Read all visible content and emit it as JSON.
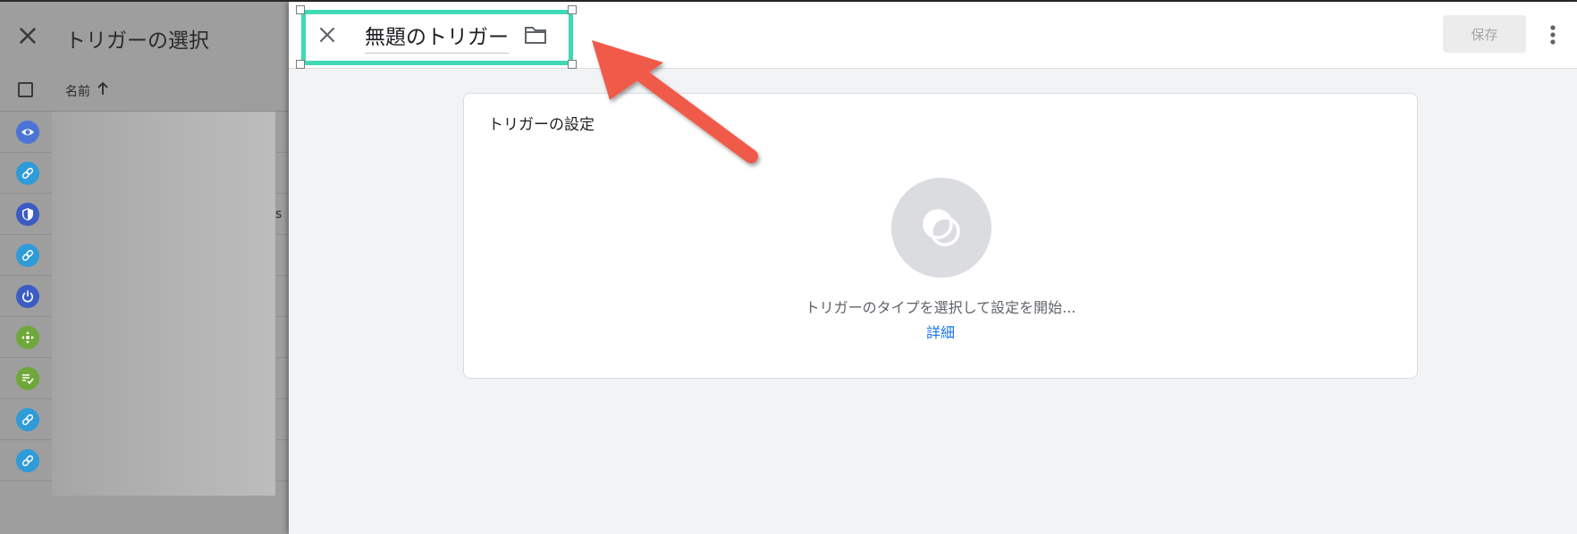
{
  "background_panel": {
    "title": "トリガーの選択",
    "column_name": "名前",
    "partial_text": "s",
    "rows": [
      {
        "icon": "eye-icon",
        "color": "#4285f4"
      },
      {
        "icon": "link-icon",
        "color": "#039be5"
      },
      {
        "icon": "shield-icon",
        "color": "#3b5dc9"
      },
      {
        "icon": "link-icon",
        "color": "#039be5"
      },
      {
        "icon": "power-icon",
        "color": "#3b5dc9"
      },
      {
        "icon": "move-icon",
        "color": "#7cb342"
      },
      {
        "icon": "form-check-icon",
        "color": "#7cb342"
      },
      {
        "icon": "link-icon",
        "color": "#039be5"
      },
      {
        "icon": "link-icon",
        "color": "#039be5"
      }
    ]
  },
  "editor": {
    "title": "無題のトリガー",
    "save_label": "保存",
    "card": {
      "title": "トリガーの設定",
      "hint": "トリガーのタイプを選択して設定を開始...",
      "link": "詳細"
    }
  },
  "annotation": {
    "highlight_color": "#3fd9b5",
    "arrow_color": "#f05a4a"
  },
  "colors": {
    "accent": "#1a73e8",
    "save_disabled_text": "#a4a4a4"
  }
}
